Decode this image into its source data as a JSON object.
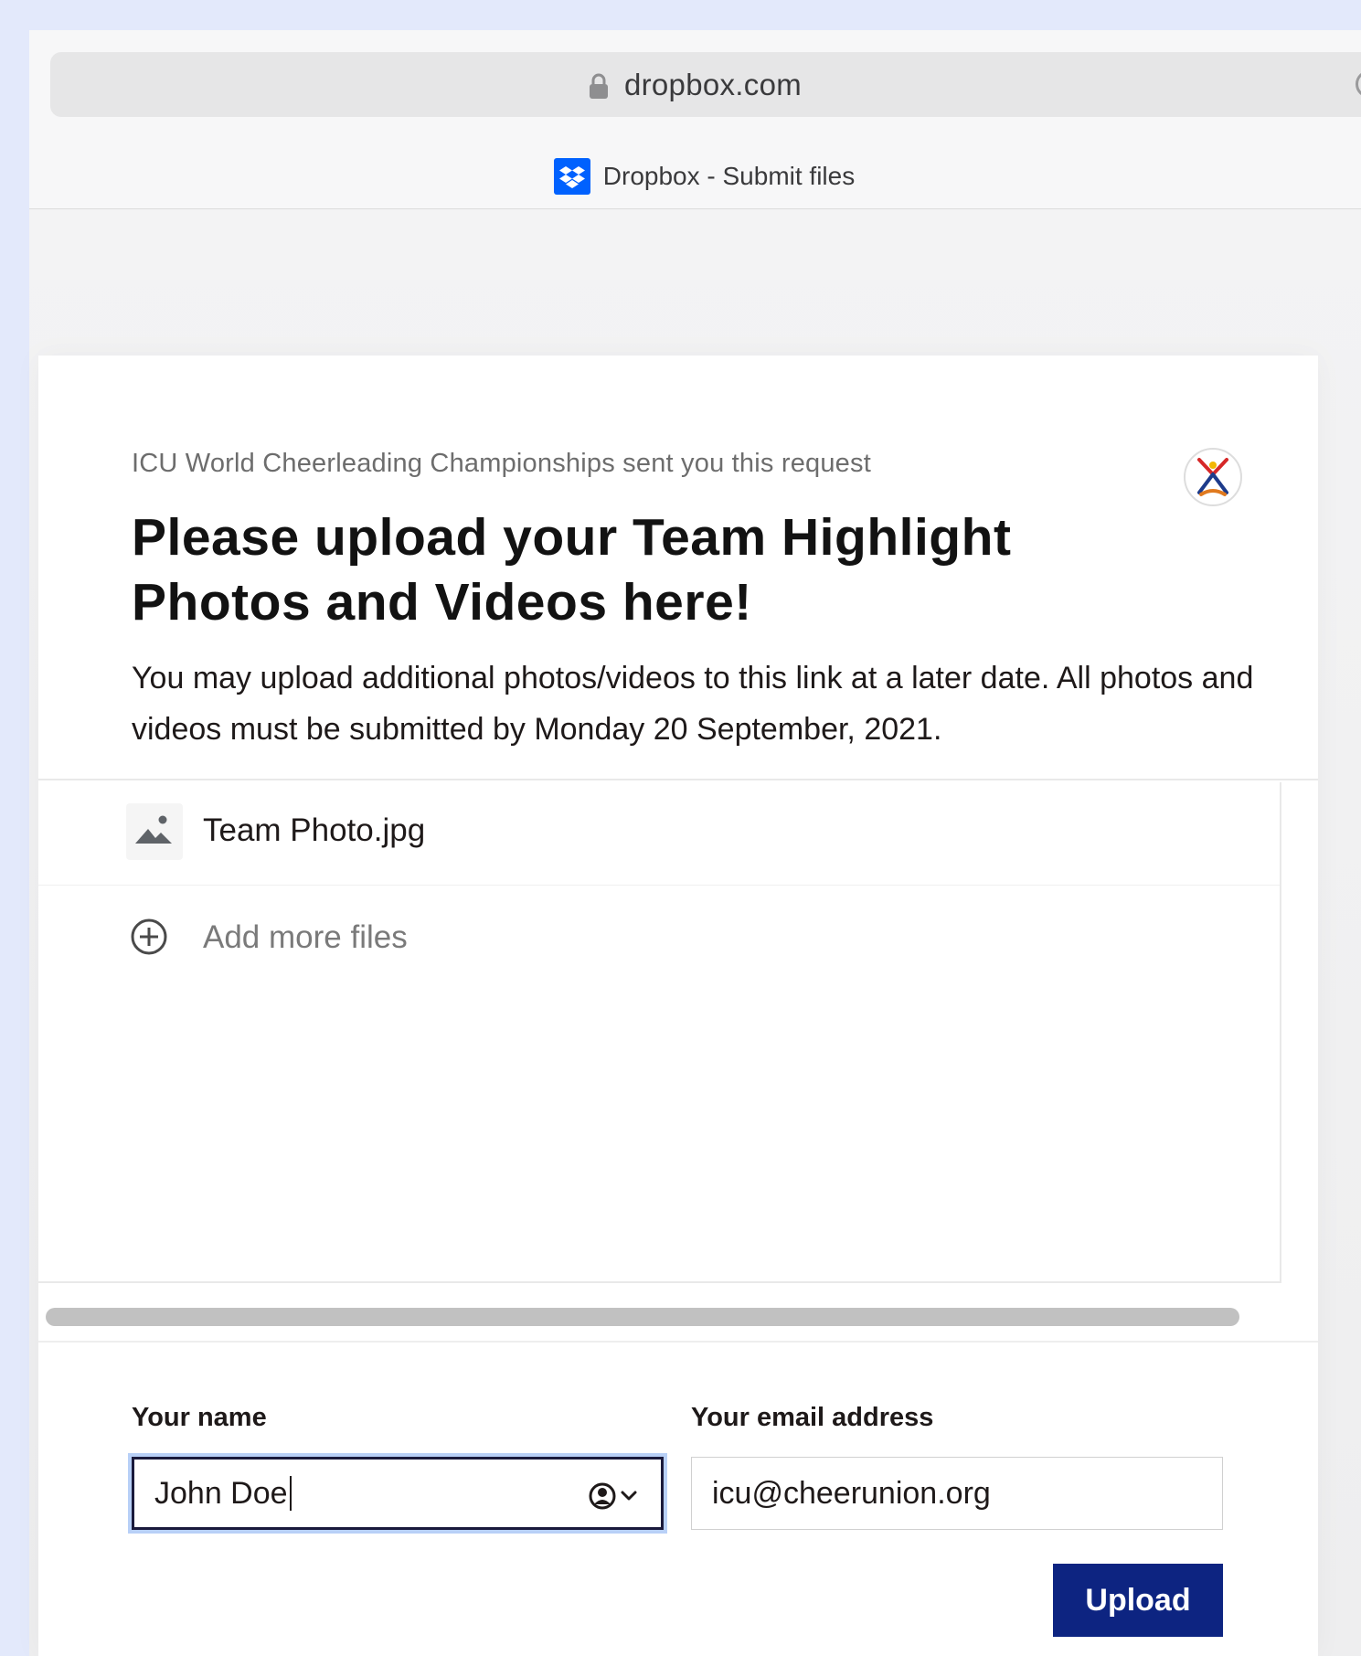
{
  "browser": {
    "url": "dropbox.com",
    "tab_title": "Dropbox - Submit files"
  },
  "request": {
    "sender_line": "ICU World Cheerleading Championships sent you this request",
    "title": "Please upload your Team Highlight Photos and Videos here!",
    "description": "You may upload additional photos/videos to this link at a later date. All photos and videos must be submitted by Monday 20 September, 2021."
  },
  "files": {
    "items": [
      {
        "name": "Team Photo.jpg",
        "icon": "image-icon"
      }
    ],
    "add_more_label": "Add more files"
  },
  "form": {
    "name_label": "Your name",
    "name_value": "John Doe",
    "email_label": "Your email address",
    "email_value": "icu@cheerunion.org",
    "upload_label": "Upload"
  },
  "colors": {
    "upload_button": "#0d2481",
    "focus_ring": "#b8d0f7",
    "dropbox_blue": "#0061fe"
  }
}
